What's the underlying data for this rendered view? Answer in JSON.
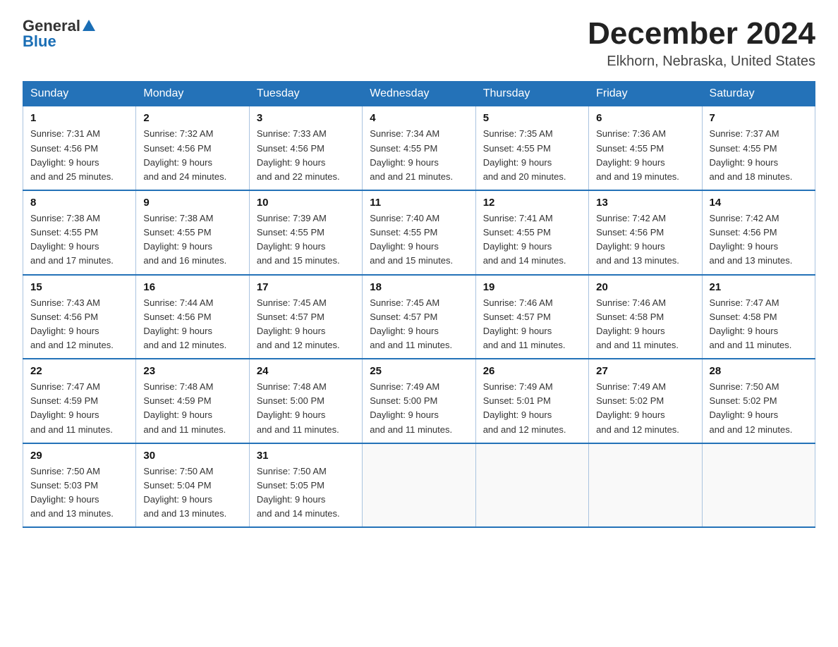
{
  "logo": {
    "general": "General",
    "triangle": "▲",
    "blue": "Blue"
  },
  "title": "December 2024",
  "subtitle": "Elkhorn, Nebraska, United States",
  "weekdays": [
    "Sunday",
    "Monday",
    "Tuesday",
    "Wednesday",
    "Thursday",
    "Friday",
    "Saturday"
  ],
  "weeks": [
    [
      {
        "day": "1",
        "sunrise": "7:31 AM",
        "sunset": "4:56 PM",
        "daylight": "9 hours and 25 minutes."
      },
      {
        "day": "2",
        "sunrise": "7:32 AM",
        "sunset": "4:56 PM",
        "daylight": "9 hours and 24 minutes."
      },
      {
        "day": "3",
        "sunrise": "7:33 AM",
        "sunset": "4:56 PM",
        "daylight": "9 hours and 22 minutes."
      },
      {
        "day": "4",
        "sunrise": "7:34 AM",
        "sunset": "4:55 PM",
        "daylight": "9 hours and 21 minutes."
      },
      {
        "day": "5",
        "sunrise": "7:35 AM",
        "sunset": "4:55 PM",
        "daylight": "9 hours and 20 minutes."
      },
      {
        "day": "6",
        "sunrise": "7:36 AM",
        "sunset": "4:55 PM",
        "daylight": "9 hours and 19 minutes."
      },
      {
        "day": "7",
        "sunrise": "7:37 AM",
        "sunset": "4:55 PM",
        "daylight": "9 hours and 18 minutes."
      }
    ],
    [
      {
        "day": "8",
        "sunrise": "7:38 AM",
        "sunset": "4:55 PM",
        "daylight": "9 hours and 17 minutes."
      },
      {
        "day": "9",
        "sunrise": "7:38 AM",
        "sunset": "4:55 PM",
        "daylight": "9 hours and 16 minutes."
      },
      {
        "day": "10",
        "sunrise": "7:39 AM",
        "sunset": "4:55 PM",
        "daylight": "9 hours and 15 minutes."
      },
      {
        "day": "11",
        "sunrise": "7:40 AM",
        "sunset": "4:55 PM",
        "daylight": "9 hours and 15 minutes."
      },
      {
        "day": "12",
        "sunrise": "7:41 AM",
        "sunset": "4:55 PM",
        "daylight": "9 hours and 14 minutes."
      },
      {
        "day": "13",
        "sunrise": "7:42 AM",
        "sunset": "4:56 PM",
        "daylight": "9 hours and 13 minutes."
      },
      {
        "day": "14",
        "sunrise": "7:42 AM",
        "sunset": "4:56 PM",
        "daylight": "9 hours and 13 minutes."
      }
    ],
    [
      {
        "day": "15",
        "sunrise": "7:43 AM",
        "sunset": "4:56 PM",
        "daylight": "9 hours and 12 minutes."
      },
      {
        "day": "16",
        "sunrise": "7:44 AM",
        "sunset": "4:56 PM",
        "daylight": "9 hours and 12 minutes."
      },
      {
        "day": "17",
        "sunrise": "7:45 AM",
        "sunset": "4:57 PM",
        "daylight": "9 hours and 12 minutes."
      },
      {
        "day": "18",
        "sunrise": "7:45 AM",
        "sunset": "4:57 PM",
        "daylight": "9 hours and 11 minutes."
      },
      {
        "day": "19",
        "sunrise": "7:46 AM",
        "sunset": "4:57 PM",
        "daylight": "9 hours and 11 minutes."
      },
      {
        "day": "20",
        "sunrise": "7:46 AM",
        "sunset": "4:58 PM",
        "daylight": "9 hours and 11 minutes."
      },
      {
        "day": "21",
        "sunrise": "7:47 AM",
        "sunset": "4:58 PM",
        "daylight": "9 hours and 11 minutes."
      }
    ],
    [
      {
        "day": "22",
        "sunrise": "7:47 AM",
        "sunset": "4:59 PM",
        "daylight": "9 hours and 11 minutes."
      },
      {
        "day": "23",
        "sunrise": "7:48 AM",
        "sunset": "4:59 PM",
        "daylight": "9 hours and 11 minutes."
      },
      {
        "day": "24",
        "sunrise": "7:48 AM",
        "sunset": "5:00 PM",
        "daylight": "9 hours and 11 minutes."
      },
      {
        "day": "25",
        "sunrise": "7:49 AM",
        "sunset": "5:00 PM",
        "daylight": "9 hours and 11 minutes."
      },
      {
        "day": "26",
        "sunrise": "7:49 AM",
        "sunset": "5:01 PM",
        "daylight": "9 hours and 12 minutes."
      },
      {
        "day": "27",
        "sunrise": "7:49 AM",
        "sunset": "5:02 PM",
        "daylight": "9 hours and 12 minutes."
      },
      {
        "day": "28",
        "sunrise": "7:50 AM",
        "sunset": "5:02 PM",
        "daylight": "9 hours and 12 minutes."
      }
    ],
    [
      {
        "day": "29",
        "sunrise": "7:50 AM",
        "sunset": "5:03 PM",
        "daylight": "9 hours and 13 minutes."
      },
      {
        "day": "30",
        "sunrise": "7:50 AM",
        "sunset": "5:04 PM",
        "daylight": "9 hours and 13 minutes."
      },
      {
        "day": "31",
        "sunrise": "7:50 AM",
        "sunset": "5:05 PM",
        "daylight": "9 hours and 14 minutes."
      },
      null,
      null,
      null,
      null
    ]
  ],
  "labels": {
    "sunrise": "Sunrise:",
    "sunset": "Sunset:",
    "daylight": "Daylight:"
  }
}
